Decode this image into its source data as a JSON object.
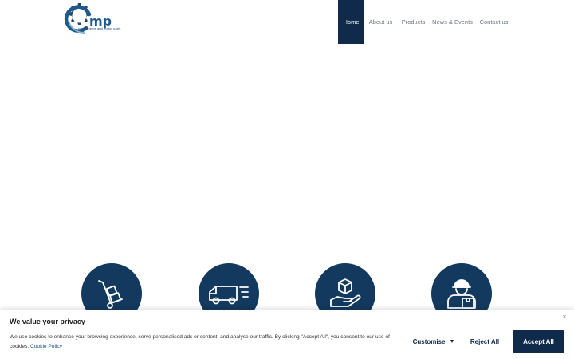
{
  "header": {
    "logo": {
      "text": "cmp",
      "tagline": "components and motor parts",
      "icon": "gear-logo-icon"
    },
    "nav": [
      {
        "label": "Home",
        "active": true
      },
      {
        "label": "About us",
        "active": false
      },
      {
        "label": "Products",
        "active": false
      },
      {
        "label": "News & Events",
        "active": false
      },
      {
        "label": "Contact us",
        "active": false
      }
    ]
  },
  "features": [
    {
      "icon": "hand-truck-icon"
    },
    {
      "icon": "delivery-van-icon"
    },
    {
      "icon": "box-in-hand-icon"
    },
    {
      "icon": "delivery-person-icon"
    }
  ],
  "cookie": {
    "title": "We value your privacy",
    "text": "We use cookies to enhance your browsing experience, serve personalised ads or content, and analyse our traffic. By clicking \"Accept All\", you consent to our use of cookies.",
    "policy_link": "Cookie Policy",
    "customise_label": "Customise",
    "reject_label": "Reject All",
    "accept_label": "Accept All",
    "close_symbol": "×"
  },
  "colors": {
    "primary": "#0f2a4a",
    "circle": "#133a5e",
    "nav_text": "#6f7a86"
  }
}
